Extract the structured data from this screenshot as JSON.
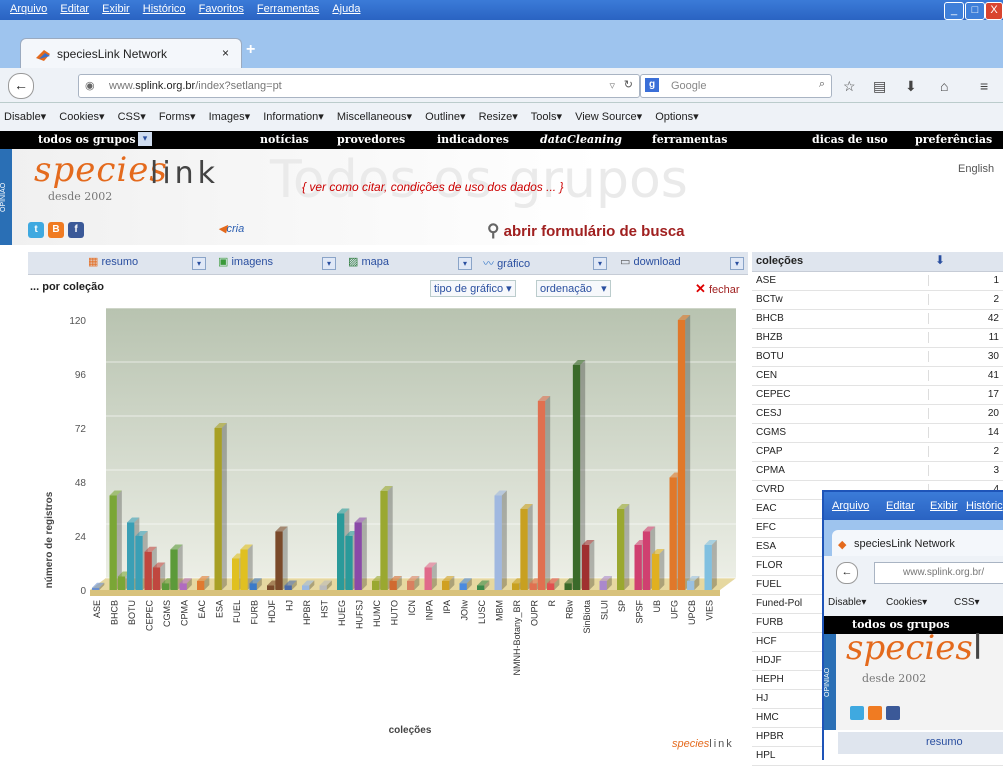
{
  "browser": {
    "menu": [
      "Arquivo",
      "Editar",
      "Exibir",
      "Histórico",
      "Favoritos",
      "Ferramentas",
      "Ajuda"
    ],
    "window_buttons": [
      "_",
      "□",
      "X"
    ],
    "tab_title": "speciesLink Network",
    "tab_close": "×",
    "new_tab": "+",
    "url_prefix": "www.",
    "url_domain": "splink.org.br",
    "url_path": "/index?setlang=pt",
    "search_placeholder": "Google"
  },
  "devbar": [
    "Disable▾",
    "Cookies▾",
    "CSS▾",
    "Forms▾",
    "Images▾",
    "Information▾",
    "Miscellaneous▾",
    "Outline▾",
    "Resize▾",
    "Tools▾",
    "View Source▾",
    "Options▾"
  ],
  "sitenav": {
    "grupos": "todos os grupos",
    "items": [
      "notícias",
      "provedores",
      "indicadores",
      "dataCleaning",
      "ferramentas",
      "dicas de uso",
      "preferências"
    ]
  },
  "header": {
    "opiniao": "OPINIÃO",
    "logo_species": "species",
    "logo_link": "link",
    "since": "desde 2002",
    "big_title": "Todos os grupos",
    "cite": "{ ver como citar, condições de uso dos dados ... }",
    "english": "English",
    "social": [
      "t",
      "B",
      "f"
    ],
    "cria": "cria",
    "abrir": "abrir formulário de busca"
  },
  "controls": {
    "resumo": "resumo",
    "imagens": "imagens",
    "mapa": "mapa",
    "grafico": "gráfico",
    "download": "download",
    "por_colecao": "... por coleção",
    "tipo_grafico": "tipo de gráfico",
    "ordenacao": "ordenação",
    "fechar": "fechar"
  },
  "table": {
    "header_col": "coleções",
    "header_icon": "⬇",
    "rows": [
      [
        "ASE",
        "1"
      ],
      [
        "BCTw",
        "2"
      ],
      [
        "BHCB",
        "42"
      ],
      [
        "BHZB",
        "11"
      ],
      [
        "BOTU",
        "30"
      ],
      [
        "CEN",
        "41"
      ],
      [
        "CEPEC",
        "17"
      ],
      [
        "CESJ",
        "20"
      ],
      [
        "CGMS",
        "14"
      ],
      [
        "CPAP",
        "2"
      ],
      [
        "CPMA",
        "3"
      ],
      [
        "CVRD",
        "4"
      ],
      [
        "EAC",
        ""
      ],
      [
        "EFC",
        ""
      ],
      [
        "ESA",
        ""
      ],
      [
        "FLOR",
        ""
      ],
      [
        "FUEL",
        ""
      ],
      [
        "Funed-Pol",
        ""
      ],
      [
        "FURB",
        ""
      ],
      [
        "HCF",
        ""
      ],
      [
        "HDJF",
        ""
      ],
      [
        "HEPH",
        ""
      ],
      [
        "HJ",
        ""
      ],
      [
        "HMC",
        ""
      ],
      [
        "HPBR",
        ""
      ],
      [
        "HPL",
        ""
      ]
    ]
  },
  "chart_data": {
    "type": "bar",
    "ylabel": "número de registros",
    "xlabel": "coleções",
    "ylim": [
      0,
      120
    ],
    "yticks": [
      0,
      24,
      48,
      72,
      96,
      120
    ],
    "categories": [
      "ASE",
      "BHCB",
      "BOTU",
      "CEPEC",
      "CGMS",
      "CPMA",
      "EAC",
      "ESA",
      "FUEL",
      "FURB",
      "HDJF",
      "HJ",
      "HPBR",
      "HST",
      "HUEG",
      "HUFSJ",
      "HUMC",
      "HUTO",
      "ICN",
      "INPA",
      "IPA",
      "JOIw",
      "LUSC",
      "MBM",
      "NMNH-Botany_BR",
      "OUPR",
      "R",
      "RBw",
      "SinBiota",
      "SLUI",
      "SP",
      "SPSF",
      "UB",
      "UFG",
      "UPCB",
      "VIES"
    ],
    "values": [
      1,
      42,
      30,
      17,
      3,
      3,
      4,
      72,
      14,
      3,
      2,
      2,
      2,
      2,
      34,
      30,
      4,
      4,
      4,
      10,
      4,
      3,
      2,
      42,
      3,
      3,
      3,
      3,
      20,
      4,
      36,
      20,
      16,
      50,
      4,
      20
    ],
    "values_2": [
      0,
      6,
      24,
      10,
      18,
      0,
      0,
      0,
      18,
      0,
      26,
      0,
      0,
      0,
      24,
      0,
      44,
      0,
      0,
      0,
      0,
      0,
      0,
      0,
      36,
      84,
      0,
      100,
      0,
      0,
      0,
      26,
      0,
      120,
      0,
      0
    ],
    "brand": "species",
    "brand_link": "link"
  },
  "overlay": {
    "menu": [
      "Arquivo",
      "Editar",
      "Exibir",
      "Históric"
    ],
    "tab_title": "speciesLink Network",
    "url": "www.splink.org.br/",
    "dev": [
      "Disable▾",
      "Cookies▾",
      "CSS▾"
    ],
    "grupos": "todos os grupos",
    "opiniao": "OPINIÃO",
    "logo": "species",
    "logo_l": "l",
    "since": "desde 2002",
    "resumo": "resumo"
  }
}
